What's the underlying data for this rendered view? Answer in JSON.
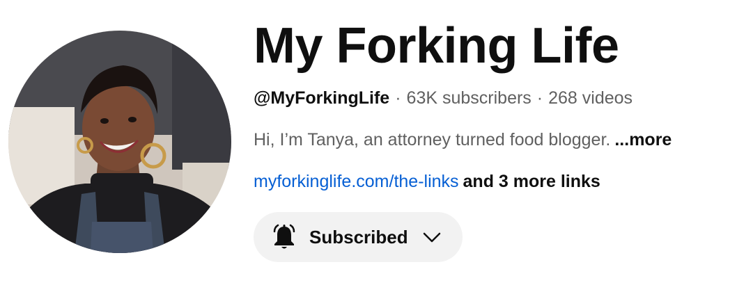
{
  "channel": {
    "title": "My Forking Life",
    "handle": "@MyForkingLife",
    "separator": "·",
    "subscribers": "63K subscribers",
    "videos": "268 videos",
    "description": "Hi, I’m Tanya, an attorney turned food blogger.",
    "more_label": "...more",
    "link_text": "myforkinglife.com/the-links",
    "more_links_text": "and 3 more links"
  },
  "subscribe": {
    "label": "Subscribed",
    "bell_icon": "bell-icon",
    "chevron_icon": "chevron-down-icon"
  },
  "avatar": {
    "icon": "avatar"
  },
  "colors": {
    "link": "#065fd4",
    "secondary_text": "#606060",
    "primary_text": "#0f0f0f",
    "button_bg": "#f2f2f2"
  }
}
